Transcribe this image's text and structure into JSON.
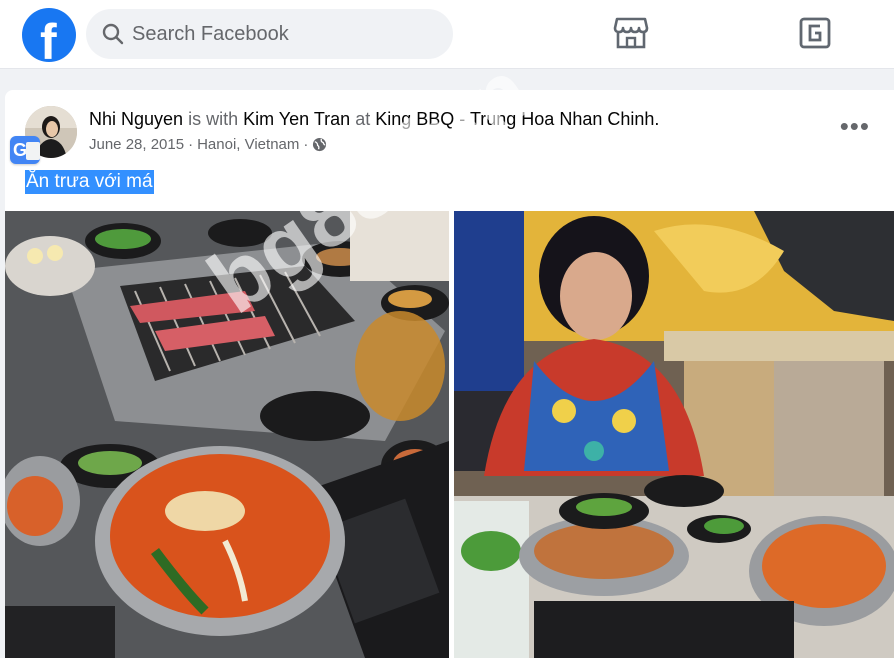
{
  "header": {
    "logo_letter": "f",
    "search": {
      "placeholder": "Search Facebook"
    },
    "nav_icons": [
      "marketplace-icon",
      "gaming-icon"
    ]
  },
  "post": {
    "author": "Nhi Nguyen",
    "with_word": "is with",
    "tagged": "Kim Yen Tran",
    "at_word": "at",
    "place": "King BBQ - Trung Hoa Nhan Chinh",
    "date": "June 28, 2015",
    "location": "Hanoi, Vietnam",
    "separator": "·",
    "caption": "Ăn trưa với má",
    "photos": [
      "korean-bbq-table-photo",
      "woman-in-restaurant-photo"
    ]
  },
  "watermark": "bg88.fun",
  "colors": {
    "brand": "#1877f2",
    "page_bg": "#f0f2f5",
    "caption_highlight": "#3390ff"
  }
}
